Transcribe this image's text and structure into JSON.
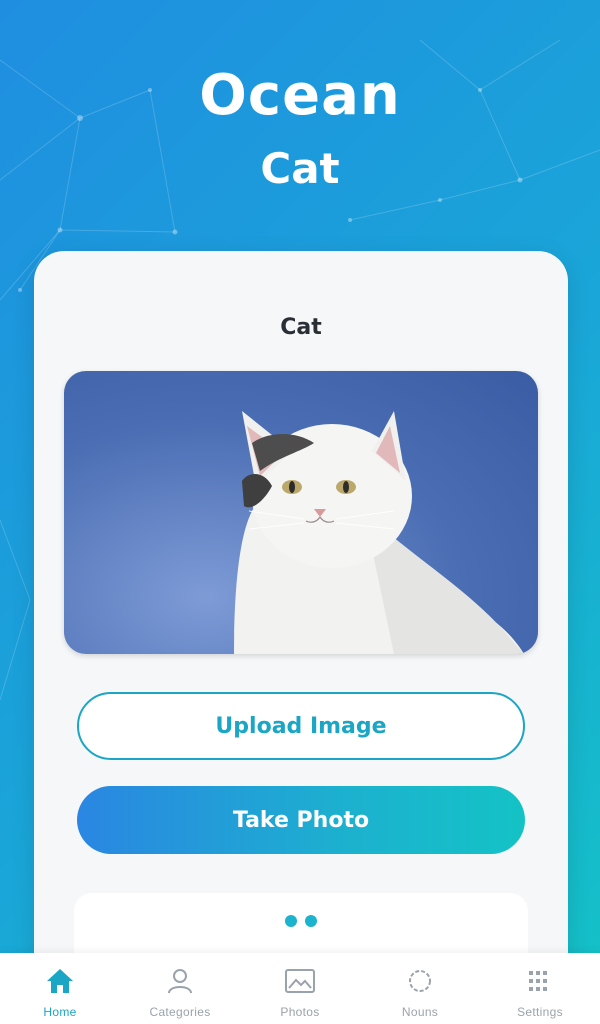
{
  "header": {
    "title": "Ocean",
    "subtitle": "Cat"
  },
  "card": {
    "title": "Cat",
    "upload_label": "Upload Image",
    "take_photo_label": "Take Photo",
    "pagination_dots": 2
  },
  "nav": {
    "items": [
      {
        "label": "Home",
        "icon": "home-icon",
        "active": true
      },
      {
        "label": "Categories",
        "icon": "user-icon",
        "active": false
      },
      {
        "label": "Photos",
        "icon": "image-icon",
        "active": false
      },
      {
        "label": "Nouns",
        "icon": "circle-icon",
        "active": false
      },
      {
        "label": "Settings",
        "icon": "grid-icon",
        "active": false
      }
    ]
  },
  "colors": {
    "accent": "#1aa6c4",
    "gradient_start": "#2a86e2",
    "gradient_end": "#14c3c6"
  }
}
